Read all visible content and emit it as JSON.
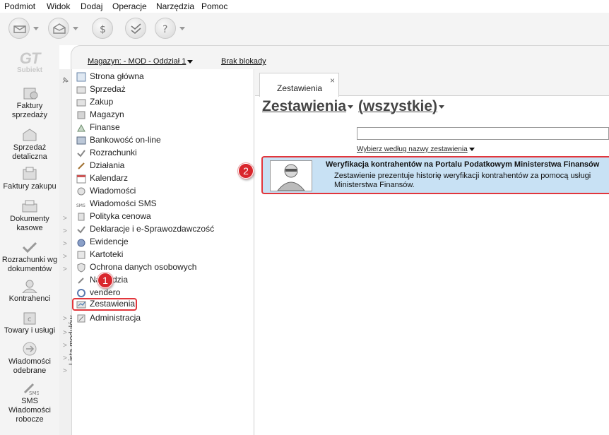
{
  "menu": [
    "Podmiot",
    "Widok",
    "Dodaj",
    "Operacje",
    "Narzędzia",
    "Pomoc"
  ],
  "logo": {
    "mark": "GT",
    "name": "Subiekt"
  },
  "left_nav": [
    {
      "label": "Faktury sprzedaży",
      "icon": "invoice-sales-icon"
    },
    {
      "label": "Sprzedaż detaliczna",
      "icon": "retail-sales-icon"
    },
    {
      "label": "Faktury zakupu",
      "icon": "purchase-invoice-icon"
    },
    {
      "label": "Dokumenty kasowe",
      "icon": "cash-document-icon"
    },
    {
      "label": "Rozrachunki wg dokumentów",
      "icon": "settlements-icon"
    },
    {
      "label": "Kontrahenci",
      "icon": "contractors-icon"
    },
    {
      "label": "Towary i usługi",
      "icon": "goods-services-icon"
    },
    {
      "label": "Wiadomości odebrane",
      "icon": "received-messages-icon"
    },
    {
      "label": "SMS Wiadomości robocze",
      "icon": "sms-drafts-icon"
    }
  ],
  "header": {
    "warehouse": "Magazyn: - MOD - Oddział 1",
    "locks": "Brak blokady"
  },
  "modules_label": "Lista modułów",
  "modules": [
    {
      "label": "Strona główna",
      "icon": "home-page-icon"
    },
    {
      "label": "Sprzedaż",
      "icon": "sales-icon"
    },
    {
      "label": "Zakup",
      "icon": "purchase-icon"
    },
    {
      "label": "Magazyn",
      "icon": "warehouse-icon"
    },
    {
      "label": "Finanse",
      "icon": "finance-icon"
    },
    {
      "label": "Bankowość on-line",
      "icon": "online-banking-icon"
    },
    {
      "label": "Rozrachunki",
      "icon": "settlements-icon"
    },
    {
      "label": "Działania",
      "icon": "actions-icon"
    },
    {
      "label": "Kalendarz",
      "icon": "calendar-icon"
    },
    {
      "label": "Wiadomości",
      "icon": "messages-icon"
    },
    {
      "label": "Wiadomości SMS",
      "icon": "sms-icon"
    },
    {
      "label": "Polityka cenowa",
      "icon": "pricing-icon"
    },
    {
      "label": "Deklaracje i e-Sprawozdawczość",
      "icon": "declarations-icon"
    },
    {
      "label": "Ewidencje",
      "icon": "records-icon"
    },
    {
      "label": "Kartoteki",
      "icon": "files-icon"
    },
    {
      "label": "Ochrona danych osobowych",
      "icon": "data-protection-icon"
    },
    {
      "label": "Narzędzia",
      "icon": "tools-icon"
    },
    {
      "label": "vendero",
      "icon": "vendero-icon"
    },
    {
      "label": "Zestawienia",
      "icon": "reports-icon",
      "selected": true
    },
    {
      "label": "Administracja",
      "icon": "administration-icon"
    }
  ],
  "tab": {
    "label": "Zestawienia",
    "close": "×"
  },
  "content": {
    "category": "Zestawienia",
    "filter": "(wszystkie)",
    "search_value": "",
    "search_hint": "Wybierz według nazwy zestawienia",
    "result": {
      "title": "Weryfikacja kontrahentów na Portalu Podatkowym Ministerstwa Finansów",
      "description": "Zestawienie prezentuje historię weryfikacji kontrahentów za pomocą usługi Ministerstwa Finansów."
    }
  },
  "badges": [
    "1",
    "2"
  ],
  "colors": {
    "highlight_border": "#e2363c",
    "badge_fill": "#d9262c",
    "result_bg": "#c8e1f4"
  }
}
